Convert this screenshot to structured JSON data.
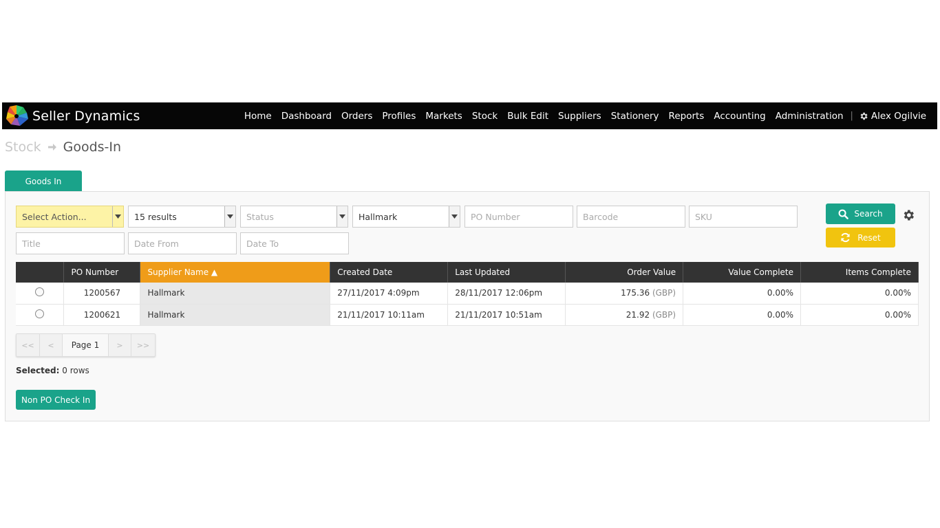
{
  "brand": {
    "name": "Seller Dynamics",
    "logo_icon": "seller-dynamics-logo"
  },
  "nav": {
    "items": [
      "Home",
      "Dashboard",
      "Orders",
      "Profiles",
      "Markets",
      "Stock",
      "Bulk Edit",
      "Suppliers",
      "Stationery",
      "Reports",
      "Accounting",
      "Administration"
    ],
    "separator": "|",
    "user_name": "Alex Ogilvie",
    "user_icon": "gear-icon"
  },
  "breadcrumb": {
    "root": "Stock",
    "current": "Goods-In"
  },
  "tab": {
    "label": "Goods In"
  },
  "filters": {
    "action_select": "Select Action...",
    "results_select": "15 results",
    "status_placeholder": "Status",
    "supplier_select": "Hallmark",
    "po_number_placeholder": "PO Number",
    "barcode_placeholder": "Barcode",
    "sku_placeholder": "SKU",
    "title_placeholder": "Title",
    "date_from_placeholder": "Date From",
    "date_to_placeholder": "Date To"
  },
  "buttons": {
    "search": "Search",
    "reset": "Reset",
    "non_po_check_in": "Non PO Check In"
  },
  "table": {
    "columns": [
      "",
      "PO Number",
      "Supplier Name ▲",
      "Created Date",
      "Last Updated",
      "Order Value",
      "Value Complete",
      "Items Complete"
    ],
    "sorted_column": "Supplier Name",
    "rows": [
      {
        "po_number": "1200567",
        "supplier": "Hallmark",
        "created": "27/11/2017 4:09pm",
        "updated": "28/11/2017 12:06pm",
        "value": "175.36",
        "currency": "(GBP)",
        "value_complete": "0.00%",
        "items_complete": "0.00%"
      },
      {
        "po_number": "1200621",
        "supplier": "Hallmark",
        "created": "21/11/2017 10:11am",
        "updated": "21/11/2017 10:51am",
        "value": "21.92",
        "currency": "(GBP)",
        "value_complete": "0.00%",
        "items_complete": "0.00%"
      }
    ]
  },
  "pager": {
    "first": "<<",
    "prev": "<",
    "page": "Page 1",
    "next": ">",
    "last": ">>"
  },
  "selection": {
    "label": "Selected:",
    "value": "0 rows"
  },
  "colors": {
    "accent_teal": "#1aa38a",
    "reset_yellow": "#f1c40f",
    "sort_orange": "#ef9c19",
    "header_dark": "#333333"
  }
}
